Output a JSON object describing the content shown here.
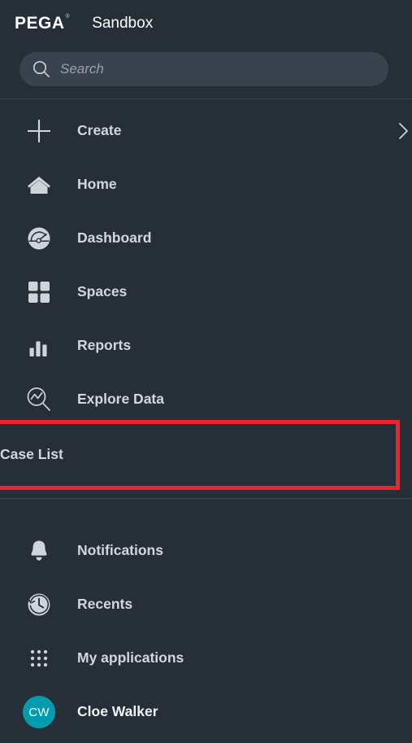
{
  "theme": {
    "background": "#262e38",
    "search_background": "#3a424e",
    "text": "#d3d7dd",
    "highlight": "#f0232c",
    "avatar": "#039cae"
  },
  "header": {
    "logo": "PEGA",
    "logo_trademark": "®",
    "environment": "Sandbox"
  },
  "search": {
    "placeholder": "Search",
    "value": "",
    "icon": "search-icon"
  },
  "nav": {
    "primary": [
      {
        "label": "Create",
        "icon": "plus-icon",
        "chevron": "chevron-right-icon",
        "has_chevron": true
      },
      {
        "label": "Home",
        "icon": "home-icon",
        "has_chevron": false
      },
      {
        "label": "Dashboard",
        "icon": "gauge-icon",
        "has_chevron": false
      },
      {
        "label": "Spaces",
        "icon": "grid-squares-icon",
        "has_chevron": false
      },
      {
        "label": "Reports",
        "icon": "bar-chart-icon",
        "has_chevron": false
      },
      {
        "label": "Explore Data",
        "icon": "magnifier-chart-icon",
        "has_chevron": false
      }
    ],
    "highlighted": {
      "label": "Case List",
      "highlight_color": "#f0232c"
    },
    "secondary": [
      {
        "label": "Notifications",
        "icon": "bell-icon"
      },
      {
        "label": "Recents",
        "icon": "history-clock-icon"
      },
      {
        "label": "My applications",
        "icon": "dot-grid-icon"
      }
    ],
    "user": {
      "label": "Cloe Walker",
      "initials": "CW",
      "icon": "avatar"
    }
  }
}
